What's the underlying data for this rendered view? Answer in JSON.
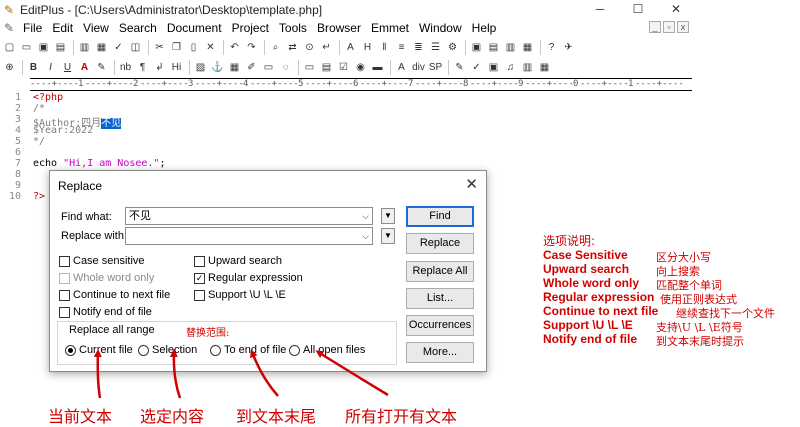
{
  "window": {
    "title": "EditPlus - [C:\\Users\\Administrator\\Desktop\\template.php]"
  },
  "menu": [
    "File",
    "Edit",
    "View",
    "Search",
    "Document",
    "Project",
    "Tools",
    "Browser",
    "Emmet",
    "Window",
    "Help"
  ],
  "toolbar2_text": [
    "B",
    "I",
    "U",
    "A",
    "nb",
    "¶",
    "Hi",
    "div",
    "SP"
  ],
  "ruler": [
    "1",
    "2",
    "3",
    "4",
    "5",
    "6",
    "7",
    "8",
    "9",
    "0",
    "1"
  ],
  "editor": {
    "line_numbers": [
      "1",
      "2",
      "3",
      "4",
      "5",
      "6",
      "7",
      "8",
      "9",
      "10"
    ],
    "lines": {
      "l1": "<?php",
      "l2": "/*",
      "l3a": "$Author:四月",
      "l3b": "不见",
      "l4": "$Year:2022",
      "l5": "*/",
      "l7a": "echo ",
      "l7b": "\"Hi,I am Nosee.\"",
      "l7c": ";",
      "l10": "?>"
    }
  },
  "dialog": {
    "title": "Replace",
    "find_label": "Find what:",
    "find_value": "不见",
    "replace_label": "Replace with:",
    "replace_value": "",
    "buttons": [
      "Find",
      "Replace",
      "Replace All",
      "List...",
      "Occurrences",
      "More..."
    ],
    "options_left": [
      "Case sensitive",
      "Whole word only",
      "Continue to next file",
      "Notify end of file"
    ],
    "options_right": [
      "Upward search",
      "Regular expression",
      "Support \\U \\L \\E"
    ],
    "regular_expression_checked": true,
    "range_label": "Replace all range",
    "range_note": "替换范围:",
    "range_options": [
      "Current file",
      "Selection",
      "To end of file",
      "All open files"
    ],
    "range_selected": "Current file"
  },
  "notes": {
    "title": "选项说明:",
    "items": [
      {
        "en": "Case Sensitive",
        "cn": "区分大小写"
      },
      {
        "en": "Upward search",
        "cn": "向上搜索"
      },
      {
        "en": "Whole word only",
        "cn": "匹配整个单词"
      },
      {
        "en": "Regular expression",
        "cn": "使用正则表达式"
      },
      {
        "en": "Continue to next file",
        "cn": "继续查找下一个文件"
      },
      {
        "en": "Support \\U \\L \\E",
        "cn": "支持\\U \\L \\E符号"
      },
      {
        "en": "Notify end of file",
        "cn": "到文本末尾时提示"
      }
    ]
  },
  "captions": [
    "当前文本",
    "选定内容",
    "到文本末尾",
    "所有打开有文本"
  ],
  "colors": {
    "annotation": "#d00000",
    "selection": "#0a64d0",
    "php_tag": "#c00000",
    "string": "#c800c8",
    "comment": "#7d7d7d"
  }
}
